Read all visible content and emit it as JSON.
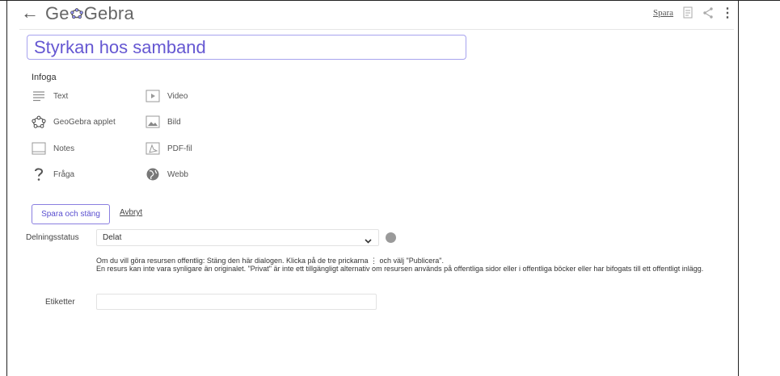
{
  "header": {
    "back_glyph": "←",
    "logo_prefix": "Ge",
    "logo_suffix": "Gebra",
    "save_link": "Spara",
    "more_glyph": "⋮"
  },
  "title_value": "Styrkan hos samband",
  "insert": {
    "heading": "Infoga",
    "items": [
      {
        "label": "Text",
        "icon": "text-lines-icon"
      },
      {
        "label": "Video",
        "icon": "video-play-icon"
      },
      {
        "label": "GeoGebra applet",
        "icon": "geogebra-applet-icon"
      },
      {
        "label": "Bild",
        "icon": "image-icon"
      },
      {
        "label": "Notes",
        "icon": "notes-icon"
      },
      {
        "label": "PDF-fil",
        "icon": "pdf-icon"
      },
      {
        "label": "Fråga",
        "icon": "question-icon"
      },
      {
        "label": "Webb",
        "icon": "web-globe-icon"
      }
    ]
  },
  "actions": {
    "save_close": "Spara och stäng",
    "cancel": "Avbryt"
  },
  "sharing": {
    "label": "Delningsstatus",
    "selected": "Delat",
    "note_line1": "Om du vill göra resursen offentlig: Stäng den här dialogen. Klicka på de tre prickarna ⋮ och välj \"Publicera\".",
    "note_line2": "En resurs kan inte vara synligare än originalet. \"Privat\" är inte ett tillgängligt alternativ om resursen används på offentliga sidor eller i offentliga böcker eller har bifogats till ett offentligt inlägg."
  },
  "tags": {
    "label": "Etiketter",
    "value": ""
  },
  "colors": {
    "accent": "#6557d2",
    "input_border": "#a7a3ee"
  }
}
